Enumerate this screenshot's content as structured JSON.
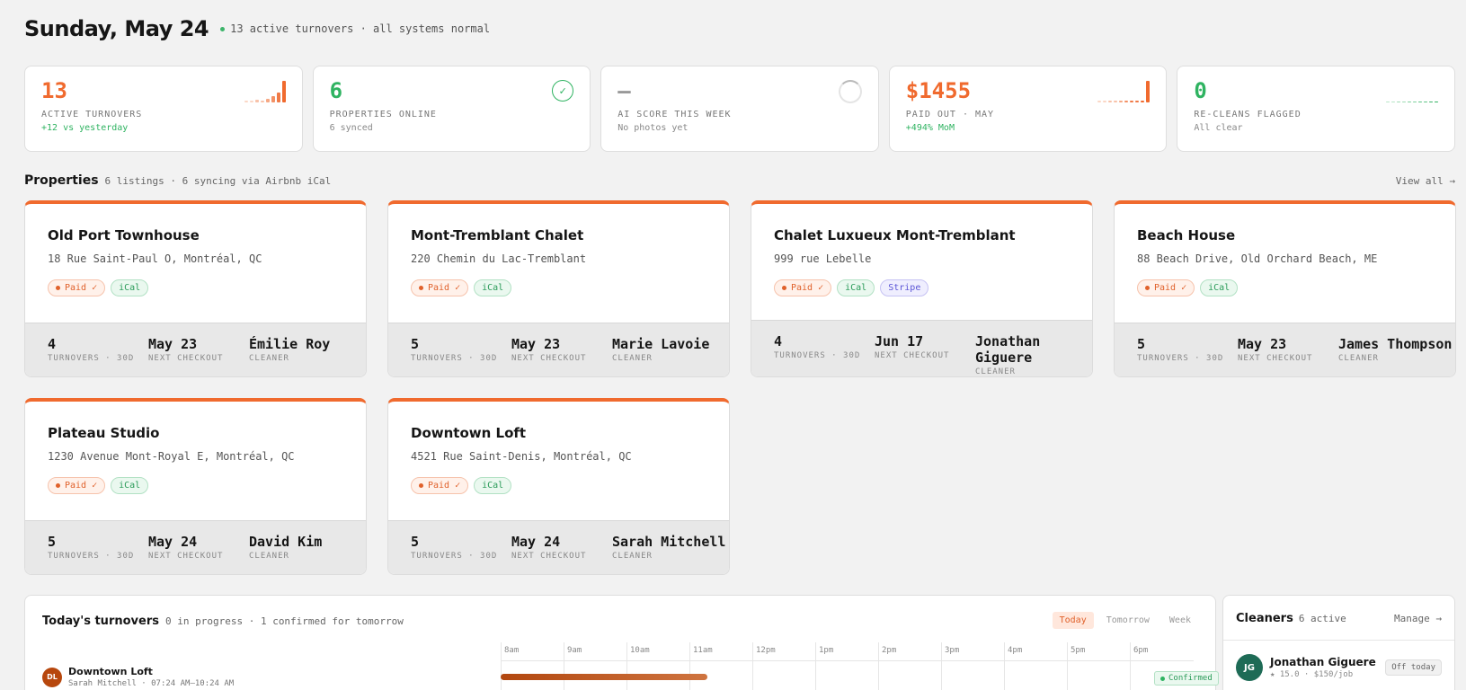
{
  "header": {
    "date": "Sunday, May 24",
    "status": "13 active turnovers · all systems normal"
  },
  "stats": [
    {
      "value": "13",
      "label": "ACTIVE TURNOVERS",
      "note": "+12 vs yesterday",
      "color": "#f06a2e"
    },
    {
      "value": "6",
      "label": "PROPERTIES ONLINE",
      "note": "6 synced",
      "color": "#2fb361"
    },
    {
      "value": "—",
      "label": "AI SCORE THIS WEEK",
      "note": "No photos yet",
      "color": "#999999"
    },
    {
      "value": "$1455",
      "label": "PAID OUT · MAY",
      "note": "+494% MoM",
      "color": "#f06a2e"
    },
    {
      "value": "0",
      "label": "RE-CLEANS FLAGGED",
      "note": "All clear",
      "color": "#2fb361"
    }
  ],
  "properties_section": {
    "title": "Properties",
    "meta": "6 listings · 6 syncing via Airbnb iCal",
    "view_all": "View all →"
  },
  "captions": {
    "turnovers": "TURNOVERS · 30D",
    "next_checkout": "NEXT CHECKOUT",
    "cleaner": "CLEANER"
  },
  "properties": [
    {
      "name": "Old Port Townhouse",
      "address": "18 Rue Saint-Paul O, Montréal, QC",
      "badges": [
        "Paid ✓",
        "iCal"
      ],
      "turnovers": "4",
      "next_checkout": "May 23",
      "cleaner": "Émilie Roy"
    },
    {
      "name": "Mont-Tremblant Chalet",
      "address": "220 Chemin du Lac-Tremblant",
      "badges": [
        "Paid ✓",
        "iCal"
      ],
      "turnovers": "5",
      "next_checkout": "May 23",
      "cleaner": "Marie Lavoie"
    },
    {
      "name": "Chalet Luxueux Mont-Tremblant",
      "address": "999 rue Lebelle",
      "badges": [
        "Paid ✓",
        "iCal",
        "Stripe"
      ],
      "turnovers": "4",
      "next_checkout": "Jun 17",
      "cleaner": "Jonathan Giguere"
    },
    {
      "name": "Beach House",
      "address": "88 Beach Drive, Old Orchard Beach, ME",
      "badges": [
        "Paid ✓",
        "iCal"
      ],
      "turnovers": "5",
      "next_checkout": "May 23",
      "cleaner": "James Thompson"
    },
    {
      "name": "Plateau Studio",
      "address": "1230 Avenue Mont-Royal E, Montréal, QC",
      "badges": [
        "Paid ✓",
        "iCal"
      ],
      "turnovers": "5",
      "next_checkout": "May 24",
      "cleaner": "David Kim"
    },
    {
      "name": "Downtown Loft",
      "address": "4521 Rue Saint-Denis, Montréal, QC",
      "badges": [
        "Paid ✓",
        "iCal"
      ],
      "turnovers": "5",
      "next_checkout": "May 24",
      "cleaner": "Sarah Mitchell"
    }
  ],
  "turnovers_panel": {
    "title": "Today's turnovers",
    "meta": "0 in progress · 1 confirmed for tomorrow",
    "tabs": [
      "Today",
      "Tomorrow",
      "Week"
    ],
    "hours": [
      "8am",
      "9am",
      "10am",
      "11am",
      "12pm",
      "1pm",
      "2pm",
      "3pm",
      "4pm",
      "5pm",
      "6pm"
    ],
    "row": {
      "initials": "DL",
      "property": "Downtown Loft",
      "detail": "Sarah Mitchell · 07:24 AM–10:24 AM",
      "status": "Confirmed"
    }
  },
  "cleaners_panel": {
    "title": "Cleaners",
    "meta": "6 active",
    "manage": "Manage →",
    "cleaner": {
      "initials": "JG",
      "name": "Jonathan Giguere",
      "detail": "★ 15.0 · $150/job",
      "status": "Off today"
    }
  }
}
